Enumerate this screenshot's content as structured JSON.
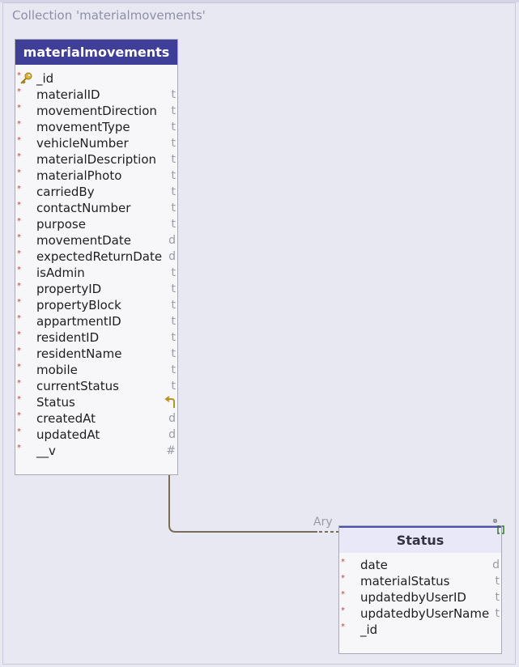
{
  "collection": {
    "title": "Collection 'materialmovements'"
  },
  "main_entity": {
    "name": "materialmovements",
    "fields": [
      {
        "name": "_id",
        "type": "",
        "icon": "key-icon"
      },
      {
        "name": "materialID",
        "type": "t"
      },
      {
        "name": "movementDirection",
        "type": "t"
      },
      {
        "name": "movementType",
        "type": "t"
      },
      {
        "name": "vehicleNumber",
        "type": "t"
      },
      {
        "name": "materialDescription",
        "type": "t"
      },
      {
        "name": "materialPhoto",
        "type": "t"
      },
      {
        "name": "carriedBy",
        "type": "t"
      },
      {
        "name": "contactNumber",
        "type": "t"
      },
      {
        "name": "purpose",
        "type": "t"
      },
      {
        "name": "movementDate",
        "type": "d"
      },
      {
        "name": "expectedReturnDate",
        "type": "d"
      },
      {
        "name": "isAdmin",
        "type": "t"
      },
      {
        "name": "propertyID",
        "type": "t"
      },
      {
        "name": "propertyBlock",
        "type": "t"
      },
      {
        "name": "appartmentID",
        "type": "t"
      },
      {
        "name": "residentID",
        "type": "t"
      },
      {
        "name": "residentName",
        "type": "t"
      },
      {
        "name": "mobile",
        "type": "t"
      },
      {
        "name": "currentStatus",
        "type": "t"
      },
      {
        "name": "Status",
        "type": "",
        "icon": "return-arrow-icon"
      },
      {
        "name": "createdAt",
        "type": "d"
      },
      {
        "name": "updatedAt",
        "type": "d"
      },
      {
        "name": "__v",
        "type": "#"
      }
    ]
  },
  "status_entity": {
    "name": "Status",
    "fields": [
      {
        "name": "date",
        "type": "d"
      },
      {
        "name": "materialStatus",
        "type": "t"
      },
      {
        "name": "updatedbyUserID",
        "type": "t"
      },
      {
        "name": "updatedbyUserName",
        "type": "t"
      },
      {
        "name": "_id",
        "type": ""
      }
    ]
  },
  "relationship": {
    "label": "Ary",
    "array_marker": "[]"
  },
  "required_marker": "*",
  "colors": {
    "header_main": "#3f3f9a",
    "header_status": "#e8e8f8",
    "required": "#c84040",
    "type_text": "#9a9aa8",
    "connector": "#7a6e58"
  }
}
